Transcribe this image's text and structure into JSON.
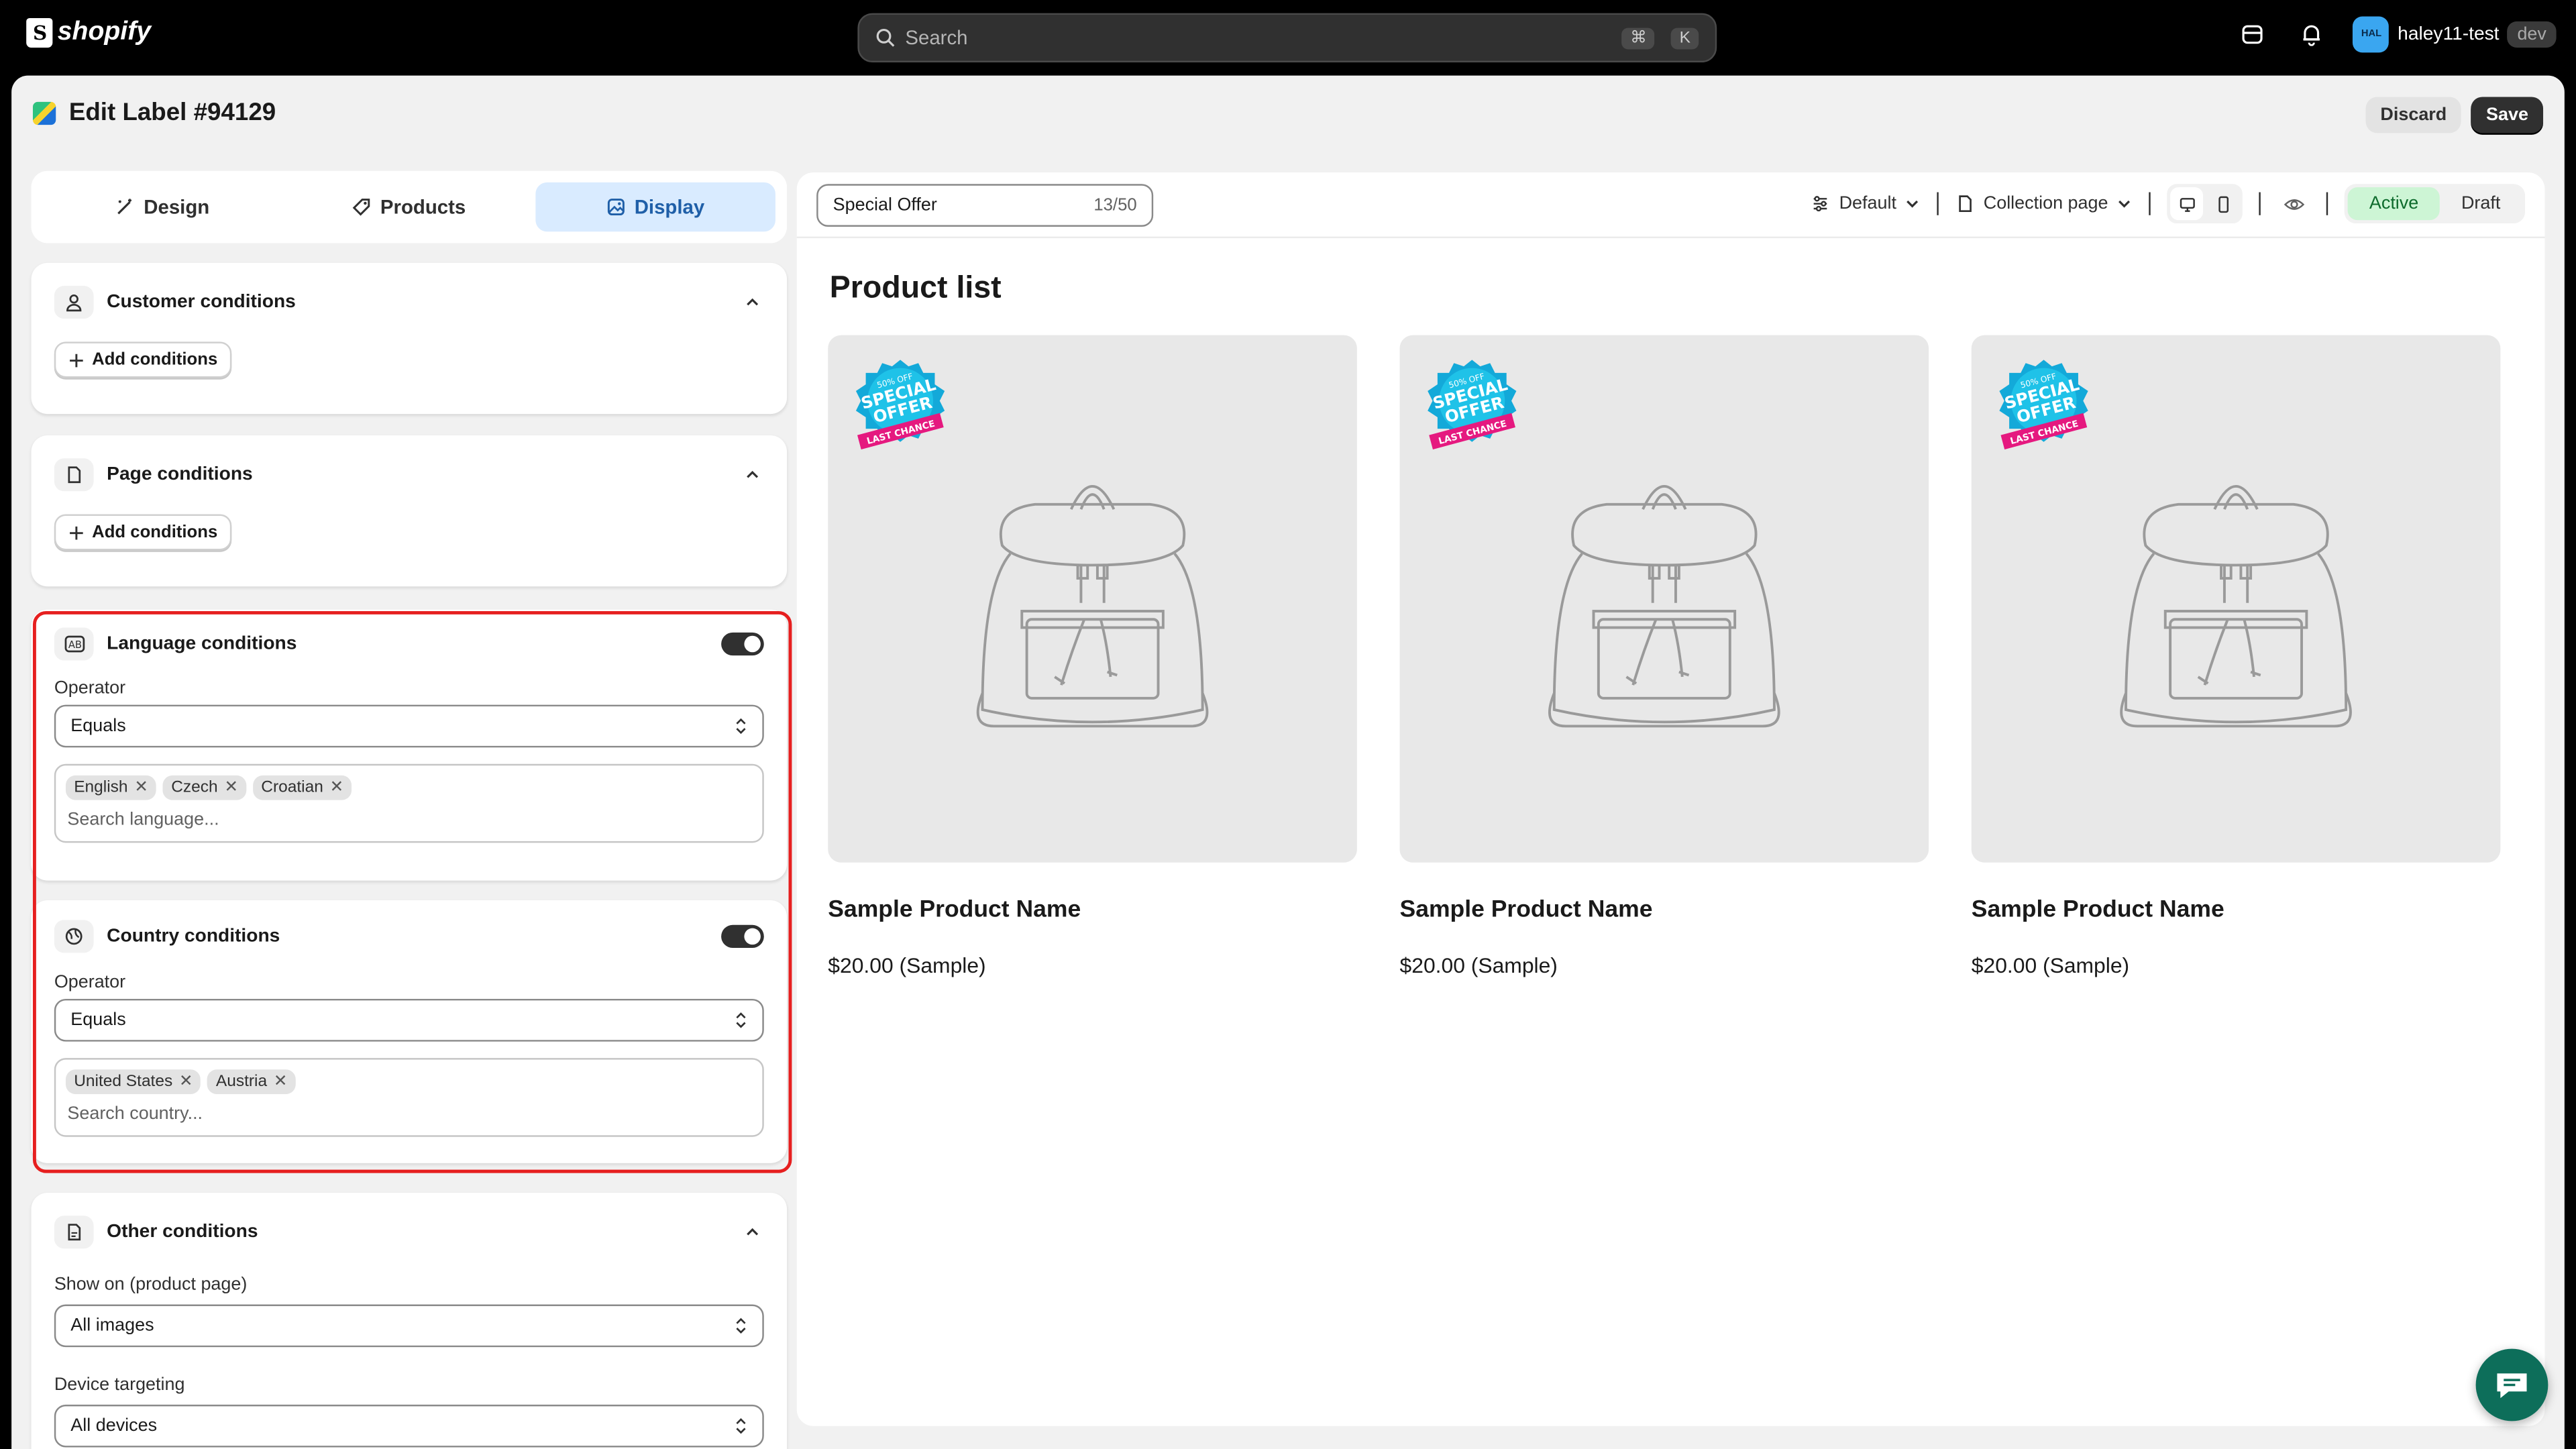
{
  "topbar": {
    "brand": "shopify",
    "search_placeholder": "Search",
    "shortcut_cmd": "⌘",
    "shortcut_key": "K",
    "user_initials": "HAL",
    "user_name": "haley11-test",
    "user_badge": "dev"
  },
  "header": {
    "title": "Edit Label #94129",
    "discard_label": "Discard",
    "save_label": "Save"
  },
  "tabs": [
    {
      "label": "Design",
      "icon": "magic-wand-icon"
    },
    {
      "label": "Products",
      "icon": "tag-icon"
    },
    {
      "label": "Display",
      "icon": "image-icon",
      "active": true
    }
  ],
  "conditions": {
    "customer": {
      "title": "Customer conditions",
      "add_label": "Add conditions"
    },
    "page": {
      "title": "Page conditions",
      "add_label": "Add conditions"
    },
    "language": {
      "title": "Language conditions",
      "enabled": true,
      "operator_label": "Operator",
      "operator_value": "Equals",
      "tags": [
        "English",
        "Czech",
        "Croatian"
      ],
      "search_placeholder": "Search language..."
    },
    "country": {
      "title": "Country conditions",
      "enabled": true,
      "operator_label": "Operator",
      "operator_value": "Equals",
      "tags": [
        "United States",
        "Austria"
      ],
      "search_placeholder": "Search country..."
    },
    "other": {
      "title": "Other conditions",
      "show_on_label": "Show on (product page)",
      "show_on_value": "All images",
      "device_label": "Device targeting",
      "device_value": "All devices"
    }
  },
  "preview": {
    "label_name": "Special Offer",
    "label_count": "13/50",
    "theme_dropdown": "Default",
    "page_dropdown": "Collection page",
    "status_active": "Active",
    "status_draft": "Draft",
    "list_title": "Product list",
    "sticker": {
      "top": "50% OFF",
      "line1": "SPECIAL",
      "line2": "OFFER",
      "ribbon": "LAST CHANCE"
    },
    "products": [
      {
        "name": "Sample Product Name",
        "price": "$20.00 (Sample)"
      },
      {
        "name": "Sample Product Name",
        "price": "$20.00 (Sample)"
      },
      {
        "name": "Sample Product Name",
        "price": "$20.00 (Sample)"
      }
    ]
  },
  "colors": {
    "accent_tab": "#d9ebff",
    "active_status": "#cdf5d5",
    "highlight_border": "#e61f1f",
    "chat_button": "#0d6e5a"
  }
}
